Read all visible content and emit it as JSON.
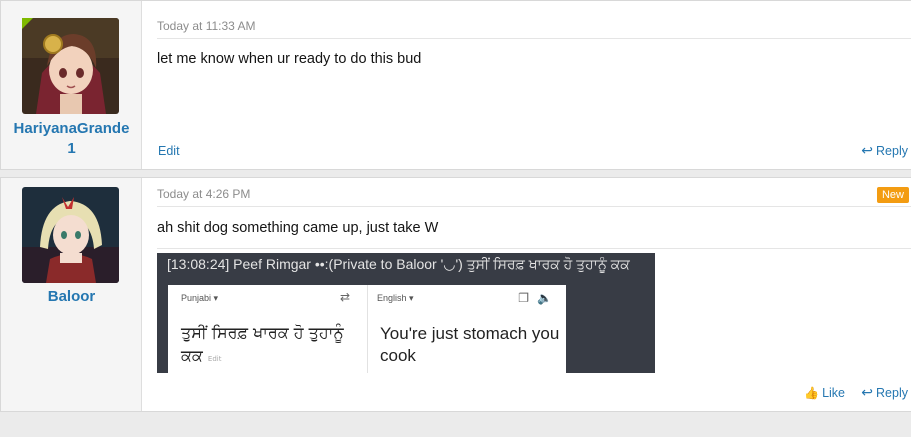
{
  "posts": [
    {
      "username": "HariyanaGrande1",
      "username_lines": [
        "HariyanaGrande",
        "1"
      ],
      "time": "Today at 11:33 AM",
      "message": "let me know when ur ready to do this bud",
      "actions": {
        "edit": "Edit",
        "reply": "Reply"
      }
    },
    {
      "username": "Baloor",
      "time": "Today at 4:26 PM",
      "badge": "New",
      "message": "ah shit dog something came up, just take W",
      "attachment": {
        "header": "[13:08:24] Peef Rimgar ••:(Private to Baloor '◡') ਤੁਸੀਂ ਸਿਰਫ਼ ਖਾਰਕ ਹੋ ਤੁਹਾਨੂੰ ਕਕ",
        "source_lang": "Punjabi ▾",
        "target_lang": "English ▾",
        "source_text": "ਤੁਸੀਂ ਸਿਰਫ਼ ਖਾਰਕ ਹੋ ਤੁਹਾਨੂੰ ਕਕ",
        "source_edit": "Edit",
        "target_text": "You're just stomach you cook"
      },
      "actions": {
        "like": "Like",
        "reply": "Reply"
      }
    }
  ],
  "colors": {
    "link": "#2577b1",
    "badge": "#f39c12",
    "online": "#7fb900"
  },
  "icons": {
    "reply": "reply-arrow-icon",
    "like": "thumbs-up-icon"
  }
}
